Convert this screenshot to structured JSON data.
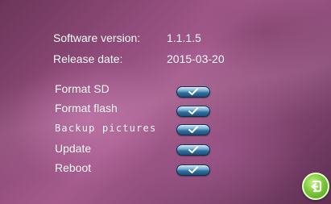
{
  "info": {
    "software_version_label": "Software version:",
    "software_version_value": "1.1.1.5",
    "release_date_label": "Release date:",
    "release_date_value": "2015-03-20"
  },
  "menu": {
    "items": [
      {
        "label": "Format SD",
        "action_icon": "check-icon"
      },
      {
        "label": "Format flash",
        "action_icon": "check-icon"
      },
      {
        "label": "Backup pictures",
        "action_icon": "check-icon"
      },
      {
        "label": "Update",
        "action_icon": "check-icon"
      },
      {
        "label": "Reboot",
        "action_icon": "check-icon"
      }
    ]
  },
  "footer": {
    "back_icon": "return-icon"
  },
  "colors": {
    "background_accent": "#a45b8c",
    "text": "#ffffff",
    "ok_button": "#2f6f9f",
    "back_button": "#7fca3a"
  }
}
